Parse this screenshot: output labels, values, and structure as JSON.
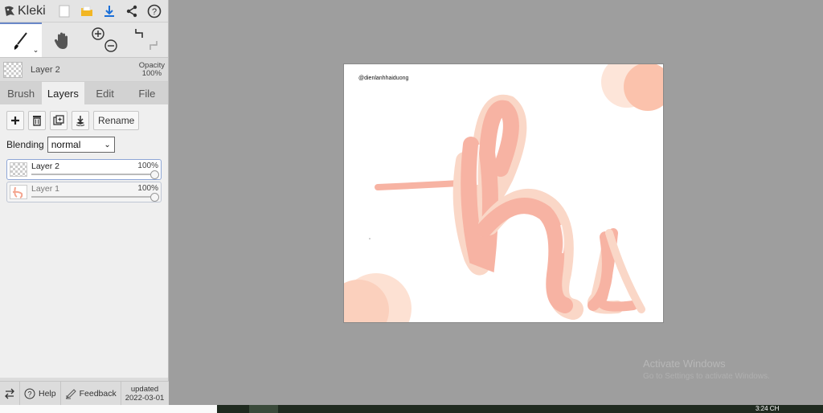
{
  "app": {
    "name": "Kleki"
  },
  "topbar_icons": [
    "new-file-icon",
    "open-folder-icon",
    "download-icon",
    "share-icon",
    "help-icon"
  ],
  "tools": {
    "brush": "brush-tool-icon",
    "hand": "hand-tool-icon",
    "zoom_in": "zoom-in-icon",
    "zoom_out": "zoom-out-icon",
    "undo": "undo-icon",
    "redo": "redo-icon"
  },
  "current_layer": {
    "name": "Layer 2",
    "opacity_label": "Opacity",
    "opacity_value": "100%"
  },
  "tabs": [
    {
      "label": "Brush"
    },
    {
      "label": "Layers"
    },
    {
      "label": "Edit"
    },
    {
      "label": "File"
    }
  ],
  "layers_panel": {
    "rename_label": "Rename",
    "blending_label": "Blending",
    "blending_value": "normal",
    "layers": [
      {
        "name": "Layer 2",
        "opacity": "100%",
        "selected": true
      },
      {
        "name": "Layer 1",
        "opacity": "100%",
        "selected": false
      }
    ]
  },
  "footer": {
    "help": "Help",
    "feedback": "Feedback",
    "updated_label": "updated",
    "updated_date": "2022-03-01"
  },
  "canvas": {
    "handle_text": "@dienlanhhaiduong"
  },
  "watermark": {
    "title": "Activate Windows",
    "subtitle": "Go to Settings to activate Windows."
  },
  "taskbar": {
    "clock": "3:24 CH"
  },
  "colors": {
    "accent": "#6a88c8",
    "peach": "#f7b3a3",
    "peach_light": "#fad7c7"
  }
}
